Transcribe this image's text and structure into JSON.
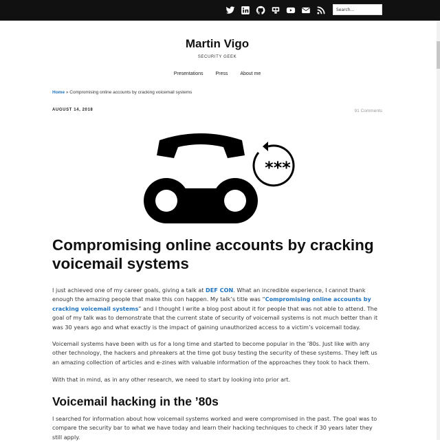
{
  "topbar": {
    "social_icons": [
      "twitter-icon",
      "linkedin-icon",
      "github-icon",
      "speakerdeck-icon",
      "youtube-icon",
      "email-icon",
      "rss-icon"
    ],
    "search_placeholder": "Search..."
  },
  "header": {
    "site_title": "Martin Vigo",
    "tagline": "SECURITY GEEK",
    "nav": [
      "Presentations",
      "Press",
      "About me"
    ]
  },
  "breadcrumb": {
    "home": "Home",
    "separator": " » ",
    "current": "Compromising online accounts by cracking voicemail systems"
  },
  "post": {
    "date": "AUGUST 14, 2018",
    "comments": "91 Comments",
    "hero_stars": "***",
    "title": "Compromising online accounts by cracking voicemail systems",
    "p1": {
      "t1": "I just achieved one of my career goals, giving a talk at ",
      "link1": "DEF CON",
      "t2": ". What an incredible experience, I cannot thank enough the amazing people that make this con happen. My talk’s title was “",
      "link2": "Compromising online accounts by cracking voicemail systems",
      "t3": "” and I thought I write a blog post about it for people that was not able to attend. The goal of my talk was to demonstrate that the current state of security of voicemail systems is not much better than it was 30 years ago and what exactly is the impact of gaining unauthorized access to a victim’s voicemail today."
    },
    "p2": "Voicemail systems have been with us for a long time and started to become popular in the ’80s. Just like with any other technology, the hackers and phreakers at the time got busy testing the security of these systems. They left us an amazing collection of articles and e-zines with valuable information of the approaches they took to hack them.",
    "p3": "With that in mind, as in any other research, we need to start by looking into prior art.",
    "h2": "Voicemail hacking in the ’80s",
    "p4": "I searched for information about how voicemail systems worked and were compromised in the past. The goal was to compare the security bar to what we have today and learn their hacking techniques to check if 30 years later they still apply."
  },
  "colors": {
    "topbar": "#111111",
    "link": "#1e73be",
    "muted": "#999999"
  }
}
